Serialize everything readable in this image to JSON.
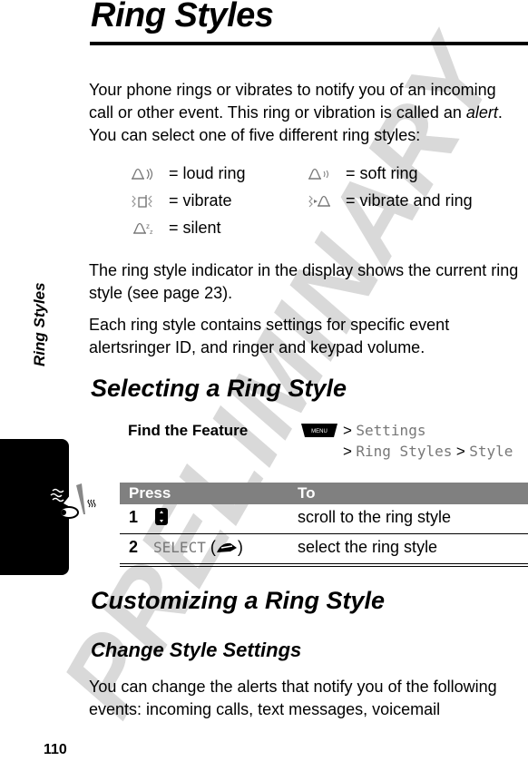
{
  "page": {
    "title": "Ring Styles",
    "side_tab_label": "Ring Styles",
    "page_number": "110",
    "watermark": "PRELIMINARY"
  },
  "intro": {
    "line_pre": "Your phone rings or vibrates to notify you of an incoming call or other event. This ring or vibration is called an ",
    "emph": "alert",
    "line_post": ". You can select one of five different ring styles:"
  },
  "legend": [
    {
      "icon": "loud-ring-icon",
      "label": "= loud ring"
    },
    {
      "icon": "soft-ring-icon",
      "label": "= soft ring"
    },
    {
      "icon": "vibrate-icon",
      "label": "= vibrate"
    },
    {
      "icon": "vibrate-and-ring-icon",
      "label": "= vibrate and ring"
    },
    {
      "icon": "silent-icon",
      "label": "= silent"
    }
  ],
  "paragraphs": [
    "The ring style indicator in the display shows the current ring style (see page 23).",
    "Each ring style contains settings for specific event alertsringer ID, and ringer and keypad volume."
  ],
  "selecting": {
    "heading": "Selecting a Ring Style",
    "find_feature_label": "Find the Feature",
    "menu_key": "MENU",
    "path": [
      {
        "sep": ">",
        "item": "Settings"
      },
      {
        "sep": ">",
        "item": "Ring Styles"
      },
      {
        "sep": ">",
        "item": "Style"
      }
    ],
    "table": {
      "headers": {
        "press": "Press",
        "to": "To"
      },
      "rows": [
        {
          "num": "1",
          "press": "",
          "press_icon": "nav-key-icon",
          "to": "scroll to the ring style"
        },
        {
          "num": "2",
          "press": "SELECT",
          "press_icon": "right-soft-key-icon",
          "to": "select the ring style"
        }
      ]
    }
  },
  "customizing": {
    "heading": "Customizing a Ring Style",
    "subheading": "Change Style Settings",
    "body": "You can change the alerts that notify you of the following events: incoming calls, text messages, voicemail"
  }
}
